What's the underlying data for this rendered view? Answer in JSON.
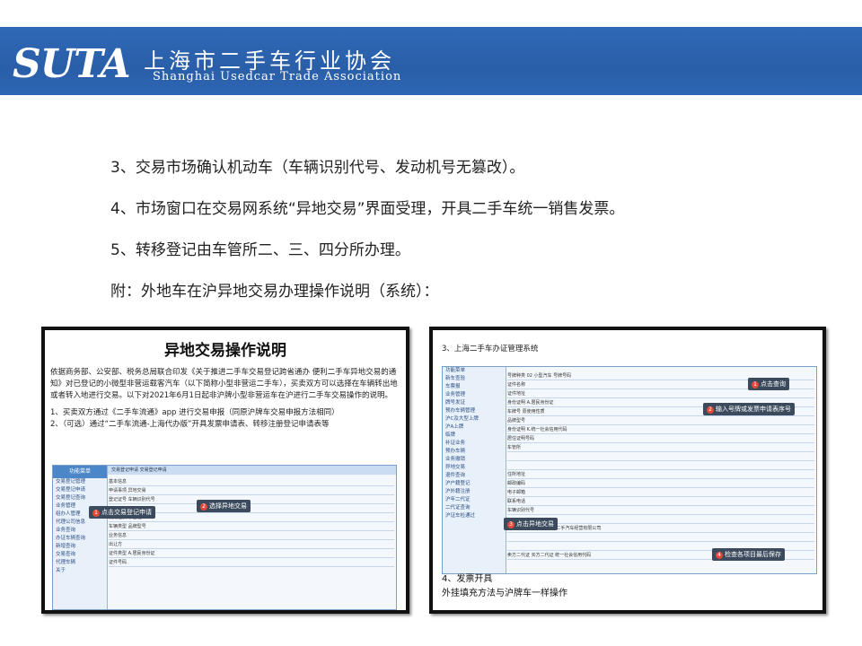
{
  "header": {
    "logo": "SUTA",
    "org_cn": "上海市二手车行业协会",
    "org_en": "Shanghai Usedcar Trade Association"
  },
  "body_lines": [
    "3、交易市场确认机动车（车辆识别代号、发动机号无篡改）。",
    "4、市场窗口在交易网系统“异地交易”界面受理，开具二手车统一销售发票。",
    "5、转移登记由车管所二、三、四分所办理。",
    "附：外地车在沪异地交易办理操作说明（系统）："
  ],
  "doc": {
    "title": "异地交易操作说明",
    "paragraph": "依据商务部、公安部、税务总局联合印发《关于推进二手车交易登记跨省通办 便利二手车异地交易的通知》对已登记的小微型非营运载客汽车（以下简称小型非营运二手车），买卖双方可以选择在车辆转出地或者转入地进行交易。以下对2021年6月1日起非沪牌小型非营运车在沪进行二手车交易操作的说明。",
    "step1": "1、买卖双方通过《二手车流通》app 进行交易申报（同原沪牌车交易申报方法相同）",
    "step2": "2、（可选）通过“二手车流通-上海代办版”开具发票申请表、转移注册登记申请表等",
    "ui_side_head": "功能菜单",
    "ui_tabs": "交易登记申请    交易登记申请",
    "callout1": "点击交易登记申请",
    "callout2": "选择异地交易",
    "side_items": [
      "交易登记管理",
      "交易登记申请",
      "交易登记查询",
      "",
      "业务管理",
      "组办人管理",
      "代理公司信息",
      "",
      "业务查询",
      "办证车辆查询",
      "新增查询",
      "交易查询",
      "代理车辆",
      "",
      "关于"
    ],
    "form_rows": [
      "基本信息",
      "申请事项  异地交易",
      "登记证号      车辆识别代号",
      "",
      "使用性质  非营运",
      "车辆类型      品牌型号",
      "业务信息",
      "出让方",
      "证件类型  A.居民身份证",
      "证件号码"
    ]
  },
  "sys": {
    "heading": "3、上海二手车办证管理系统",
    "callout1": "点击查询",
    "callout2": "输入号牌或发票申请表序号",
    "callout3": "点击异地交易",
    "callout4": "检查各项目最后保存",
    "side_items": [
      "功能菜单",
      "新车查验",
      "车票报",
      "",
      "业务管理",
      "",
      "牌号发证",
      "预办车辆管理",
      "沪C及大型上牌",
      "沪A上牌",
      "临牌",
      "补证业务",
      "预办车辆",
      "业务撤销",
      "异地交易",
      "退件查询",
      "",
      "沪户籍登记",
      "沪外籍注册",
      "沪年二代证",
      "二代证查询",
      "沪证车检通过"
    ],
    "form_rows": [
      "号牌种类  02 小型汽车   号牌号码",
      "证件名称",
      "证件地址",
      "身份证明  A.居民身份证",
      "车牌号        原使用性质",
      "品牌型号",
      "身份证明  K.统一社会信用代码",
      "居住证明号码",
      "车管所",
      "",
      "",
      "住所地址",
      "邮政编码",
      "电子邮箱",
      "联系电话",
      "车辆识别代号",
      "",
      "代理公司  0136上海市某二手汽车经营有限公司",
      "",
      "",
      "卖方二代证  买方二代证  统一社会信用代码"
    ],
    "footer1": "4、发票开具",
    "footer2": "外挂填充方法与沪牌车一样操作"
  }
}
